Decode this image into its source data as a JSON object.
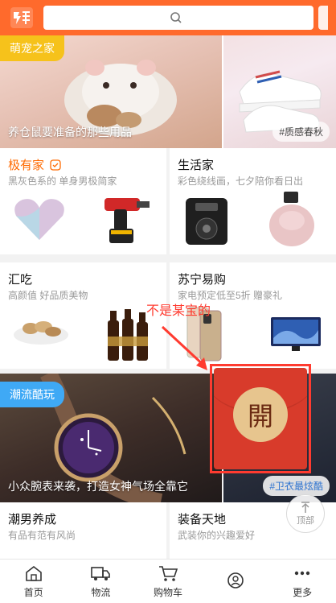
{
  "search": {
    "placeholder": ""
  },
  "banner": {
    "left_tag": "萌宠之家",
    "left_caption": "养仓鼠要准备的那些用品",
    "right_tag": "#质感春秋"
  },
  "sections": [
    {
      "title_brand": "极有家",
      "subtitle": "黑灰色系的 单身男极简家"
    },
    {
      "title": "生活家",
      "subtitle": "彩色绕线画，七夕陪你看日出"
    },
    {
      "title": "汇吃",
      "subtitle": "高颜值 好品质美物"
    },
    {
      "title": "苏宁易购",
      "subtitle": "家电预定低至5折 赠豪礼"
    }
  ],
  "trend": {
    "tag": "潮流酷玩",
    "caption": "小众腕表来袭，打造女神气场全靠它",
    "right_tag": "#卫衣最炫酷"
  },
  "bottom_sections": [
    {
      "title": "潮男养成",
      "subtitle": "有品有范有风尚"
    },
    {
      "title": "装备天地",
      "subtitle": "武装你的兴趣爱好"
    }
  ],
  "annotation": {
    "text": "不是某宝的"
  },
  "hongbao": {
    "char": "開"
  },
  "to_top": {
    "label": "顶部"
  },
  "tabbar": [
    {
      "label": "首页",
      "icon": "home-icon"
    },
    {
      "label": "物流",
      "icon": "truck-icon"
    },
    {
      "label": "购物车",
      "icon": "cart-icon"
    },
    {
      "label": "",
      "icon": "profile-icon"
    },
    {
      "label": "更多",
      "icon": "more-icon"
    }
  ],
  "colors": {
    "accent": "#ff6a2c",
    "annotation": "#ff3b30",
    "tab_tag": "#3fa9f5"
  }
}
